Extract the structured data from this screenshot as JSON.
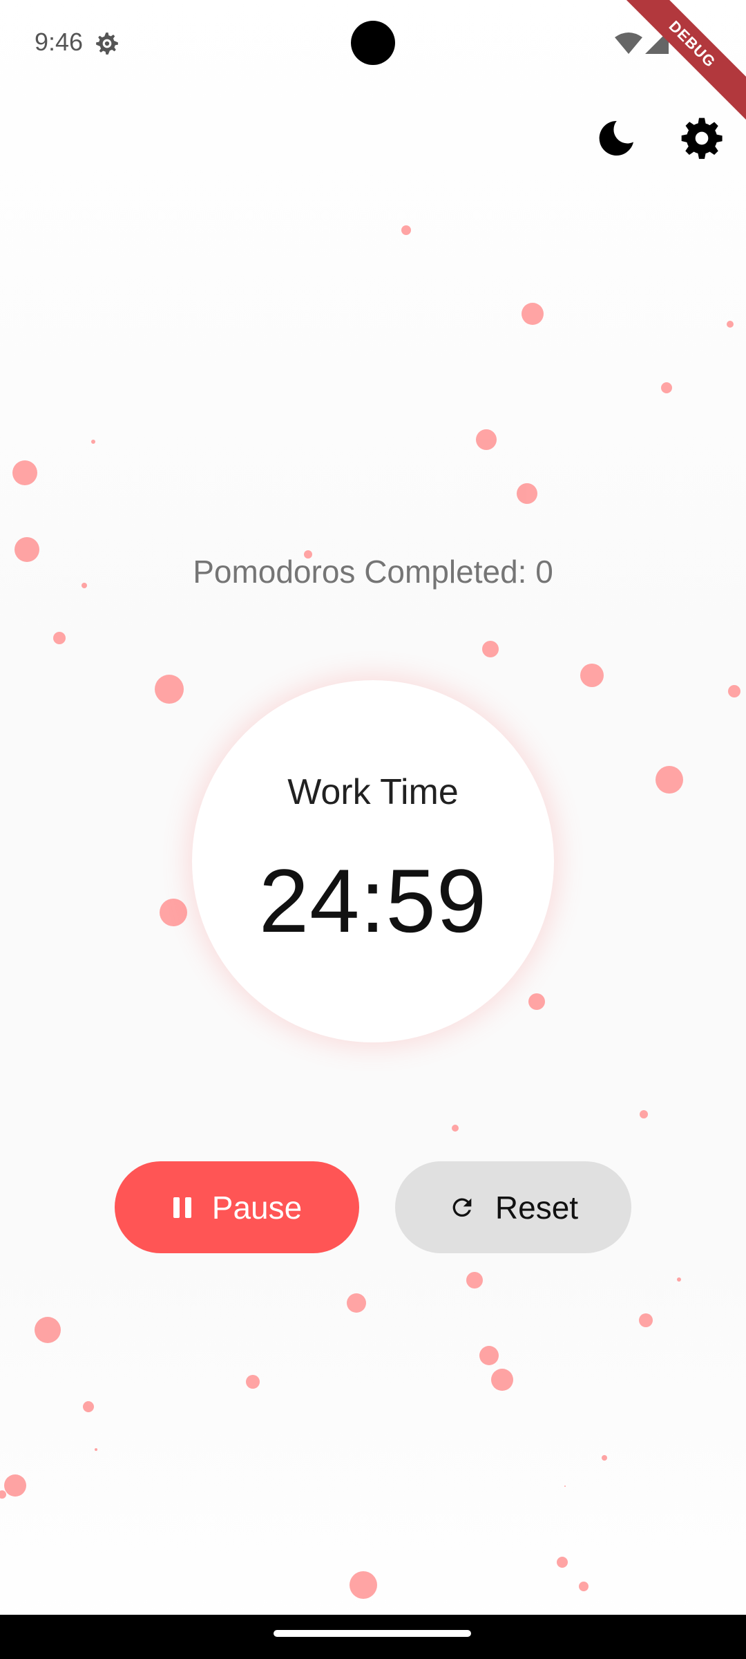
{
  "status_bar": {
    "time": "9:46",
    "icons": [
      "settings-gear-icon",
      "wifi-icon",
      "signal-icon",
      "camera-cutout"
    ]
  },
  "debug_banner": "DEBUG",
  "top_actions": {
    "theme_icon": "moon-icon",
    "settings_icon": "gear-icon"
  },
  "counter_text": "Pomodoros Completed: 0",
  "timer": {
    "mode_label": "Work Time",
    "time": "24:59"
  },
  "buttons": {
    "pause_label": "Pause",
    "pause_icon": "pause-icon",
    "reset_label": "Reset",
    "reset_icon": "refresh-icon"
  },
  "colors": {
    "accent": "#ff5555",
    "particle": "#ff8a8a",
    "reset_bg": "#e0e0e0",
    "debug": "#b2383d"
  }
}
